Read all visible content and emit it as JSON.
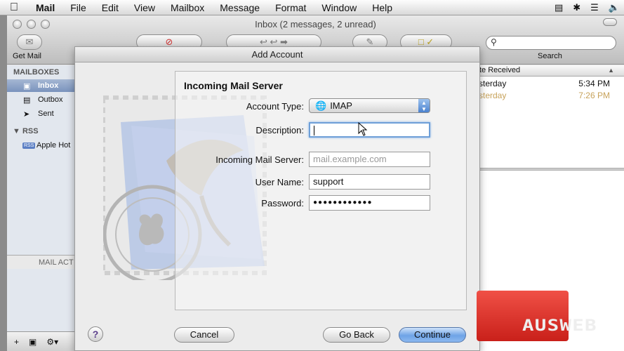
{
  "menubar": {
    "app": "Mail",
    "items": [
      "File",
      "Edit",
      "View",
      "Mailbox",
      "Message",
      "Format",
      "Window",
      "Help"
    ]
  },
  "window": {
    "title": "Inbox (2 messages, 2 unread)",
    "toolbar": {
      "get_mail_label": "Get Mail",
      "search_label": "Search"
    }
  },
  "sidebar": {
    "mailboxes_header": "MAILBOXES",
    "mailboxes": [
      {
        "label": "Inbox",
        "selected": true,
        "icon": "inbox-tray-icon"
      },
      {
        "label": "Outbox",
        "selected": false,
        "icon": "outbox-tray-icon"
      },
      {
        "label": "Sent",
        "selected": false,
        "icon": "paper-plane-icon"
      }
    ],
    "rss_header": "RSS",
    "rss_items": [
      {
        "label": "Apple Hot",
        "badge": "RSS"
      }
    ],
    "mail_activity": "MAIL ACT"
  },
  "message_list": {
    "column_header": "te Received",
    "rows": [
      {
        "day": "sterday",
        "time": "5:34 PM"
      },
      {
        "day": "sterday",
        "time": "7:26 PM"
      }
    ]
  },
  "sheet": {
    "title": "Add Account",
    "section_title": "Incoming Mail Server",
    "account_type_label": "Account Type:",
    "account_type_value": "IMAP",
    "description_label": "Description:",
    "description_value": "",
    "incoming_server_label": "Incoming Mail Server:",
    "incoming_server_placeholder": "mail.example.com",
    "user_name_label": "User Name:",
    "user_name_value": "support",
    "password_label": "Password:",
    "password_value": "●●●●●●●●●●●●",
    "help_label": "?",
    "cancel_label": "Cancel",
    "go_back_label": "Go Back",
    "continue_label": "Continue"
  },
  "watermark": {
    "text": "AUSWEB"
  },
  "colors": {
    "selection": "#7a93bd",
    "focus_ring": "#6e9fd8",
    "unread_time": "#c7a25a",
    "logo_red": "#e03a31"
  }
}
